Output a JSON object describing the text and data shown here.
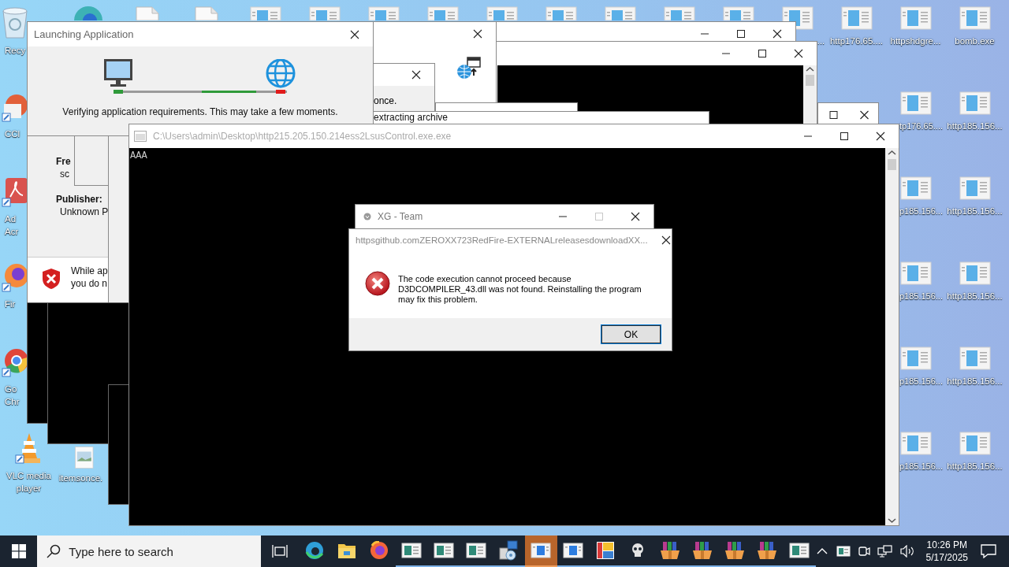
{
  "desktop": {
    "icons": [
      {
        "kind": "recycle",
        "label": "Recy"
      },
      {
        "kind": "cleaner",
        "label": "CCl"
      },
      {
        "kind": "acrobat",
        "label": "Ad Acr"
      },
      {
        "kind": "firefox",
        "label": "Fir"
      },
      {
        "kind": "chrome",
        "label": "Go Chr"
      },
      {
        "kind": "vlc",
        "label": "VLC media player"
      },
      {
        "kind": "edge"
      },
      {
        "kind": "image",
        "label": "itemsonce."
      },
      {
        "kind": "document"
      },
      {
        "kind": "document"
      },
      {
        "kind": "app"
      },
      {
        "kind": "app"
      },
      {
        "kind": "app"
      },
      {
        "kind": "app"
      },
      {
        "kind": "app"
      },
      {
        "kind": "app"
      },
      {
        "kind": "app"
      },
      {
        "kind": "app"
      },
      {
        "kind": "app"
      },
      {
        "kind": "app",
        "label": "..."
      },
      {
        "kind": "app",
        "label": "http176.65...."
      },
      {
        "kind": "app",
        "label": "httpshdgre..."
      },
      {
        "kind": "app",
        "label": "bomb.exe"
      },
      {
        "kind": "app",
        "label": "tp176.65...."
      },
      {
        "kind": "app",
        "label": "p185.156..."
      },
      {
        "kind": "app",
        "label": "p185.156..."
      },
      {
        "kind": "app",
        "label": "p185.156..."
      },
      {
        "kind": "app",
        "label": "p185.156..."
      },
      {
        "kind": "app",
        "label": "http185.156..."
      },
      {
        "kind": "app",
        "label": "http185.156..."
      },
      {
        "kind": "app",
        "label": "http185.156..."
      },
      {
        "kind": "app",
        "label": "http185.156..."
      },
      {
        "kind": "app",
        "label": "http185.156..."
      }
    ]
  },
  "security_window": {
    "from_label": "Fre",
    "from_value": "sc",
    "publisher_label": "Publisher:",
    "publisher_value": "Unknown P",
    "warning_lines": [
      "While ap",
      "you do n"
    ]
  },
  "once_window": {
    "text": "once."
  },
  "archive_window": {
    "title": "extracting archive"
  },
  "launch_window": {
    "title": "Launching Application",
    "message": "Verifying application requirements. This may take a few moments."
  },
  "console_window": {
    "title": "C:\\Users\\admin\\Desktop\\http215.205.150.214ess2LsusControl.exe.exe",
    "output": "AAA"
  },
  "xg_window": {
    "title": "XG - Team"
  },
  "error_dialog": {
    "title": "httpsgithub.comZEROXX723RedFire-EXTERNALreleasesdownloadXX...",
    "message": "The code execution cannot proceed because D3DCOMPILER_43.dll was not found. Reinstalling the program may fix this problem.",
    "button": "OK"
  },
  "taskbar": {
    "search_placeholder": "Type here to search",
    "apps": [
      {
        "kind": "edge",
        "selected": false,
        "running": false
      },
      {
        "kind": "explorer",
        "selected": false,
        "running": false
      },
      {
        "kind": "firefox",
        "selected": false,
        "running": false
      },
      {
        "kind": "window",
        "selected": false,
        "running": true
      },
      {
        "kind": "window",
        "selected": false,
        "running": true
      },
      {
        "kind": "window",
        "selected": false,
        "running": true
      },
      {
        "kind": "installer",
        "selected": false,
        "running": true
      },
      {
        "kind": "bluewindow",
        "selected": true,
        "running": true
      },
      {
        "kind": "bluewindow",
        "selected": false,
        "running": true
      },
      {
        "kind": "paint",
        "selected": false,
        "running": true
      },
      {
        "kind": "skull",
        "selected": false,
        "running": true
      },
      {
        "kind": "archive",
        "selected": false,
        "running": true
      },
      {
        "kind": "archive",
        "selected": false,
        "running": true
      },
      {
        "kind": "archive",
        "selected": false,
        "running": true
      },
      {
        "kind": "archive",
        "selected": false,
        "running": true
      },
      {
        "kind": "window",
        "selected": false,
        "running": true
      }
    ],
    "time": "10:26 PM",
    "date": "5/17/2025"
  }
}
